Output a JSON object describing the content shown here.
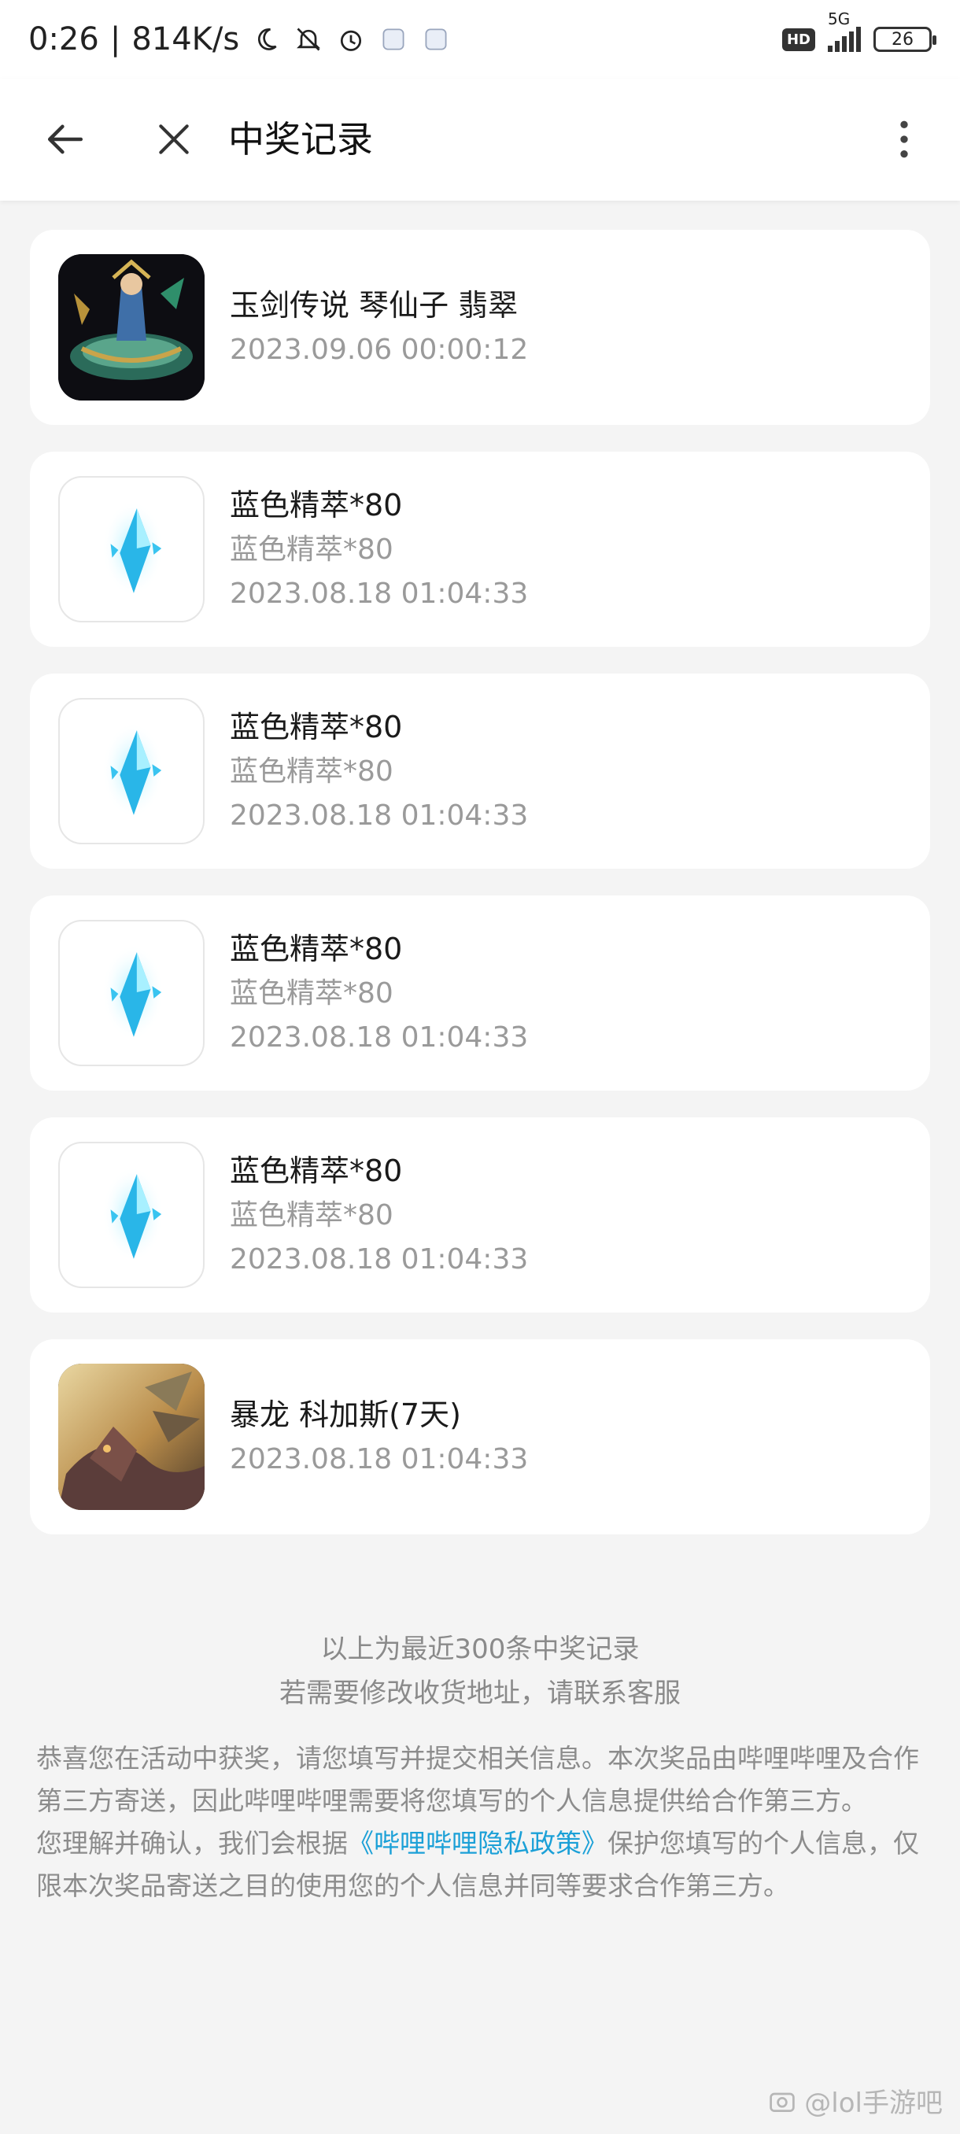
{
  "status_bar": {
    "time": "0:26",
    "speed": "814K/s",
    "network": "5G",
    "hd": "HD",
    "battery": "26"
  },
  "header": {
    "title": "中奖记录"
  },
  "records": [
    {
      "name": "玉剑传说 琴仙子 翡翠",
      "subtitle": "",
      "time": "2023.09.06 00:00:12",
      "thumb": "skin-art-sona"
    },
    {
      "name": "蓝色精萃*80",
      "subtitle": "蓝色精萃*80",
      "time": "2023.08.18 01:04:33",
      "thumb": "blue-essence-crystal"
    },
    {
      "name": "蓝色精萃*80",
      "subtitle": "蓝色精萃*80",
      "time": "2023.08.18 01:04:33",
      "thumb": "blue-essence-crystal"
    },
    {
      "name": "蓝色精萃*80",
      "subtitle": "蓝色精萃*80",
      "time": "2023.08.18 01:04:33",
      "thumb": "blue-essence-crystal"
    },
    {
      "name": "蓝色精萃*80",
      "subtitle": "蓝色精萃*80",
      "time": "2023.08.18 01:04:33",
      "thumb": "blue-essence-crystal"
    },
    {
      "name": "暴龙 科加斯(7天)",
      "subtitle": "",
      "time": "2023.08.18 01:04:33",
      "thumb": "skin-art-chogath"
    }
  ],
  "footer": {
    "line1": "以上为最近300条中奖记录",
    "line2": "若需要修改收货地址，请联系客服"
  },
  "disclaimer": {
    "para1": "恭喜您在活动中获奖，请您填写并提交相关信息。本次奖品由哔哩哔哩及合作第三方寄送，因此哔哩哔哩需要将您填写的个人信息提供给合作第三方。",
    "para2_pre": "您理解并确认，我们会根据",
    "para2_link": "《哔哩哔哩隐私政策》",
    "para2_post": "保护您填写的个人信息，仅限本次奖品寄送之目的使用您的个人信息并同等要求合作第三方。"
  },
  "watermark": "@lol手游吧",
  "colors": {
    "link": "#1ba0d7",
    "background": "#f4f4f4",
    "muted_text": "#9a9a9a"
  }
}
